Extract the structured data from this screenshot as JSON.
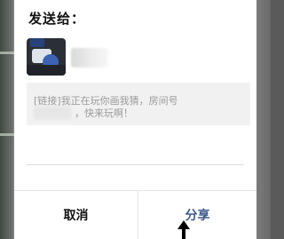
{
  "dialog": {
    "title": "发送给：",
    "message_line1": "[链接]我正在玩你画我猜，房间号",
    "message_line2": "，快来玩啊！",
    "cancel_label": "取消",
    "share_label": "分享"
  },
  "colors": {
    "share_text": "#3c5a8c",
    "message_bg": "#f1f1f1"
  }
}
